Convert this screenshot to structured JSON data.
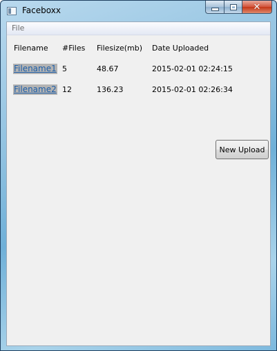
{
  "window": {
    "title": "Faceboxx",
    "close_glyph": "✕"
  },
  "menu": {
    "file_label": "File"
  },
  "table": {
    "headers": [
      "Filename",
      "#Files",
      "Filesize(mb)",
      "Date Uploaded"
    ],
    "rows": [
      {
        "filename": "Filename1",
        "files": "5",
        "filesize": "48.67",
        "date": "2015-02-01 02:24:15"
      },
      {
        "filename": "Filename2",
        "files": "12",
        "filesize": "136.23",
        "date": "2015-02-01 02:26:34"
      }
    ]
  },
  "actions": {
    "new_upload_label": "New Upload"
  },
  "icons": {
    "app": "window-icon",
    "minimize": "minimize-icon",
    "maximize": "maximize-icon",
    "close": "close-icon"
  }
}
